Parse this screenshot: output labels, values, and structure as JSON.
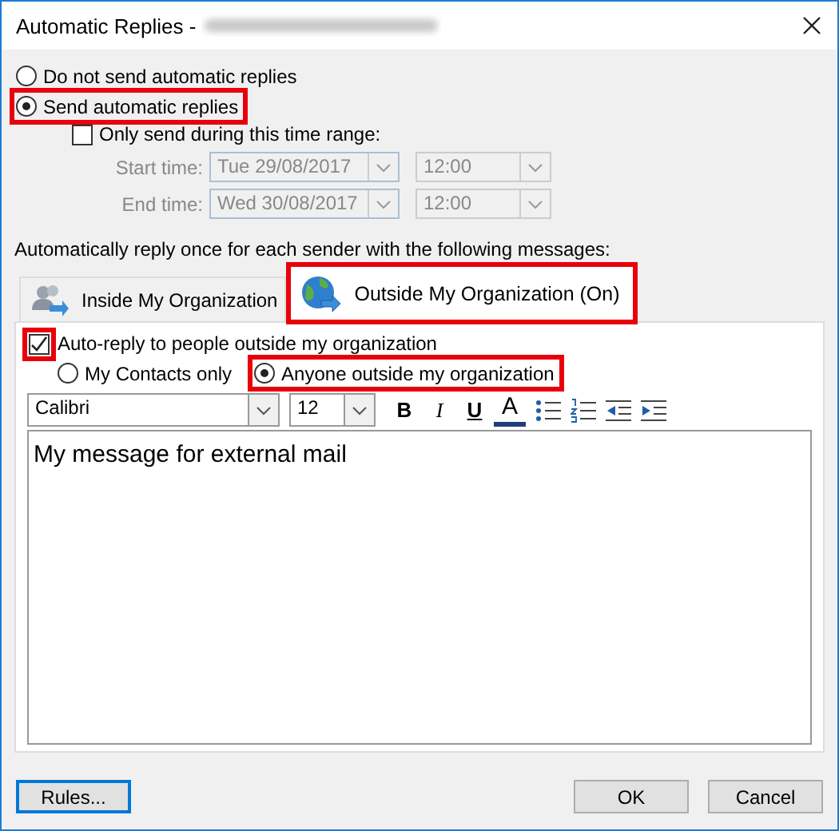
{
  "window": {
    "title": "Automatic Replies -"
  },
  "reply_mode": [
    {
      "label": "Do not send automatic replies",
      "selected": false,
      "highlighted": false
    },
    {
      "label": "Send automatic replies",
      "selected": true,
      "highlighted": true
    }
  ],
  "time_range": {
    "label": "Only send during this time range:",
    "checked": false,
    "rows": [
      {
        "label": "Start time:",
        "date": "Tue 29/08/2017",
        "time": "12:00"
      },
      {
        "label": "End time:",
        "date": "Wed 30/08/2017",
        "time": "12:00"
      }
    ]
  },
  "tabs_label": "Automatically reply once for each sender with the following messages:",
  "tabs": [
    {
      "label": "Inside My Organization",
      "selected": false,
      "kind": "people",
      "highlighted": false
    },
    {
      "label": "Outside My Organization (On)",
      "selected": true,
      "kind": "globe",
      "highlighted": true
    }
  ],
  "auto_reply": {
    "label": "Auto-reply to people outside my organization",
    "checked": true,
    "highlighted": true
  },
  "audience": [
    {
      "label": "My Contacts only",
      "selected": false,
      "highlighted": false
    },
    {
      "label": "Anyone outside my organization",
      "selected": true,
      "highlighted": true
    }
  ],
  "toolbar": {
    "font": "Calibri",
    "size": "12",
    "tools": [
      {
        "kind": "bold",
        "label": "B"
      },
      {
        "kind": "italic",
        "label": "I"
      },
      {
        "kind": "underline",
        "label": "U"
      },
      {
        "kind": "color",
        "label": "A"
      },
      {
        "kind": "bullets"
      },
      {
        "kind": "numbering"
      },
      {
        "kind": "outdent"
      },
      {
        "kind": "indent"
      }
    ]
  },
  "message": "My message for external mail",
  "buttons": [
    {
      "label": "Rules...",
      "focused": true
    },
    {
      "label": "OK",
      "focused": false
    },
    {
      "label": "Cancel",
      "focused": false
    }
  ]
}
